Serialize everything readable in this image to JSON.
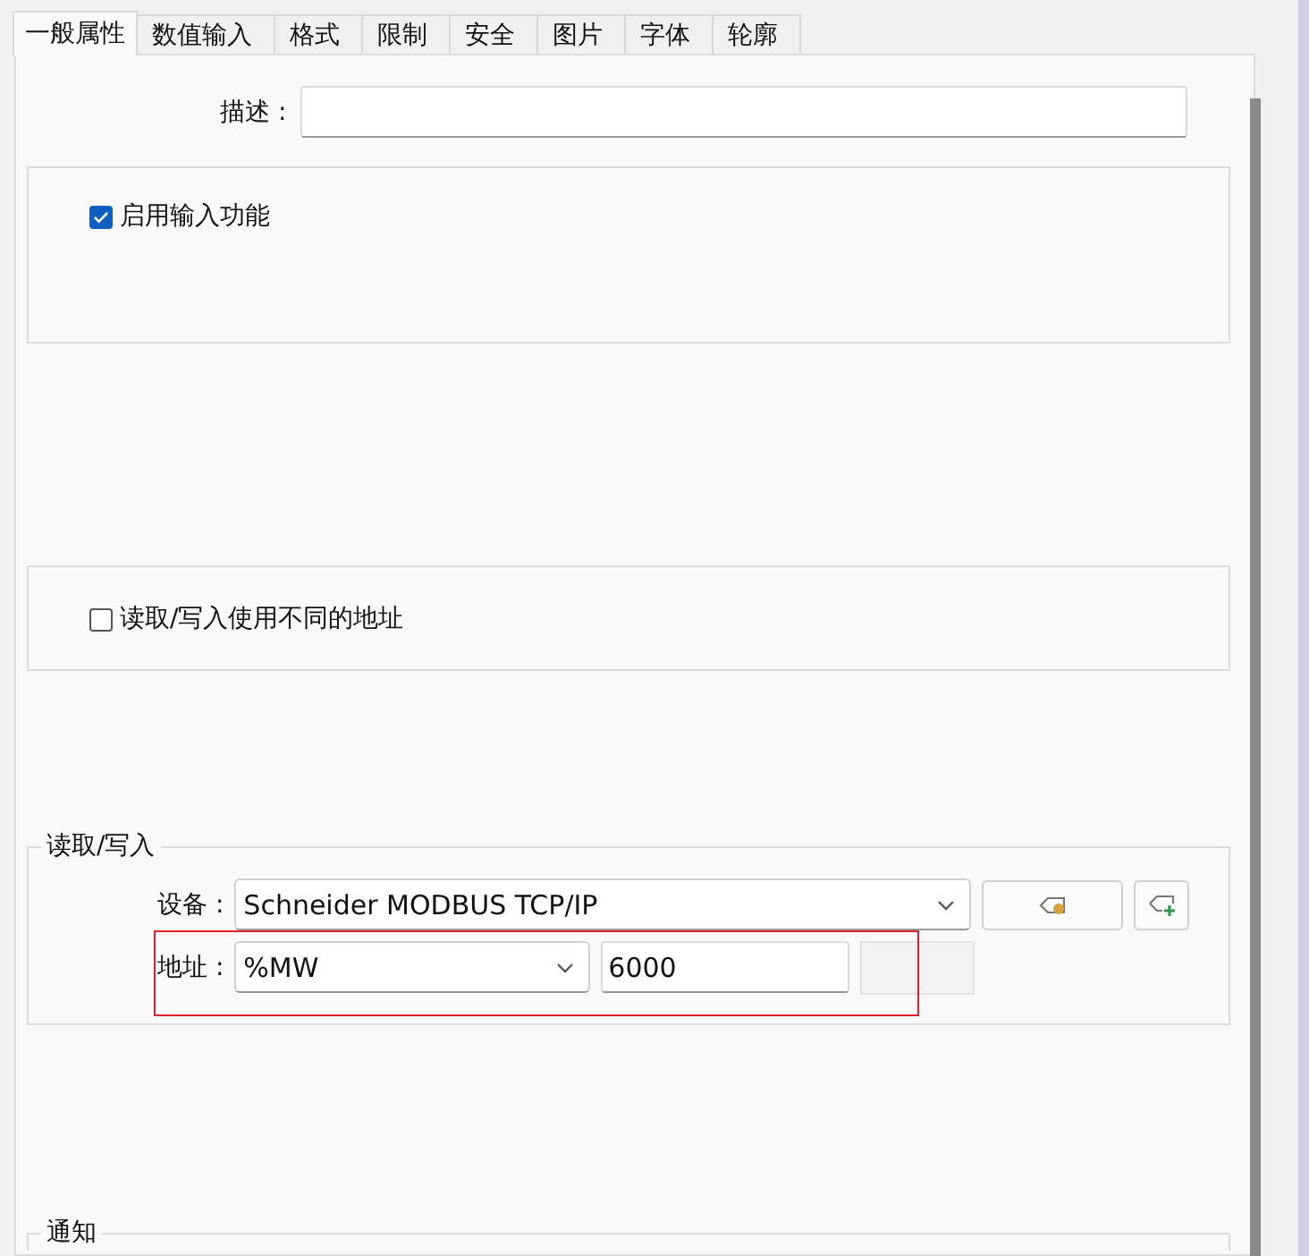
{
  "tabs": [
    {
      "label": "一般属性",
      "selected": true
    },
    {
      "label": "数值输入",
      "selected": false
    },
    {
      "label": "格式",
      "selected": false
    },
    {
      "label": "限制",
      "selected": false
    },
    {
      "label": "安全",
      "selected": false
    },
    {
      "label": "图片",
      "selected": false
    },
    {
      "label": "字体",
      "selected": false
    },
    {
      "label": "轮廓",
      "selected": false
    }
  ],
  "description": {
    "label": "描述 :"
  },
  "enable_input": {
    "label": "启用输入功能",
    "checked": true
  },
  "different_addresses": {
    "label": "读取/写入使用不同的地址",
    "checked": false
  },
  "read_write": {
    "title": "读取/写入",
    "device": {
      "label": "设备 :",
      "value": "Schneider MODBUS TCP/IP"
    },
    "address": {
      "label": "地址 :",
      "type": "%MW",
      "value": "6000",
      "highlighted": true
    }
  },
  "notification": {
    "title": "通知"
  }
}
